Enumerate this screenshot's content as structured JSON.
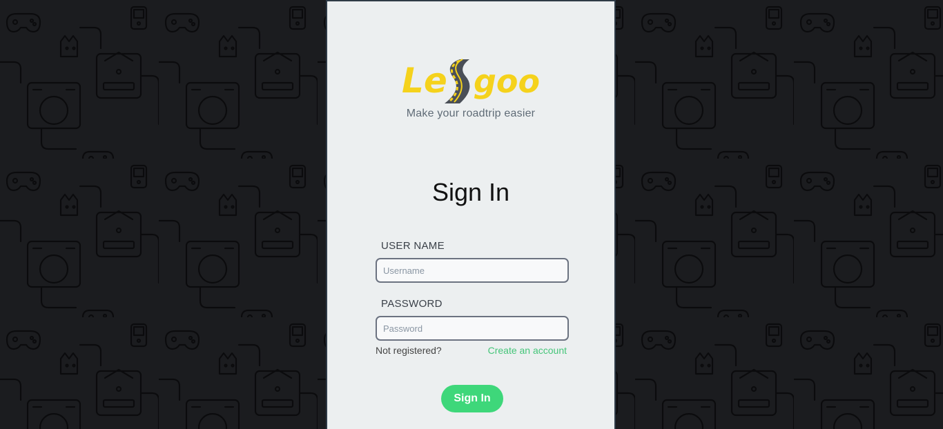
{
  "brand": {
    "logo_text_left": "Le",
    "logo_text_right": "goo",
    "tagline": "Make your roadtrip easier",
    "logo_color": "#f5d21c",
    "road_color": "#4a4f57"
  },
  "form": {
    "title": "Sign In",
    "username_label": "USER NAME",
    "username_placeholder": "Username",
    "username_value": "",
    "password_label": "PASSWORD",
    "password_placeholder": "Password",
    "password_value": "",
    "not_registered_text": "Not registered?",
    "create_account_link": "Create an account",
    "submit_label": "Sign In",
    "accent_color": "#3ed77a"
  },
  "background": {
    "pattern": "gaming-controllers-consoles-doodle",
    "color": "#1b1c1f"
  }
}
